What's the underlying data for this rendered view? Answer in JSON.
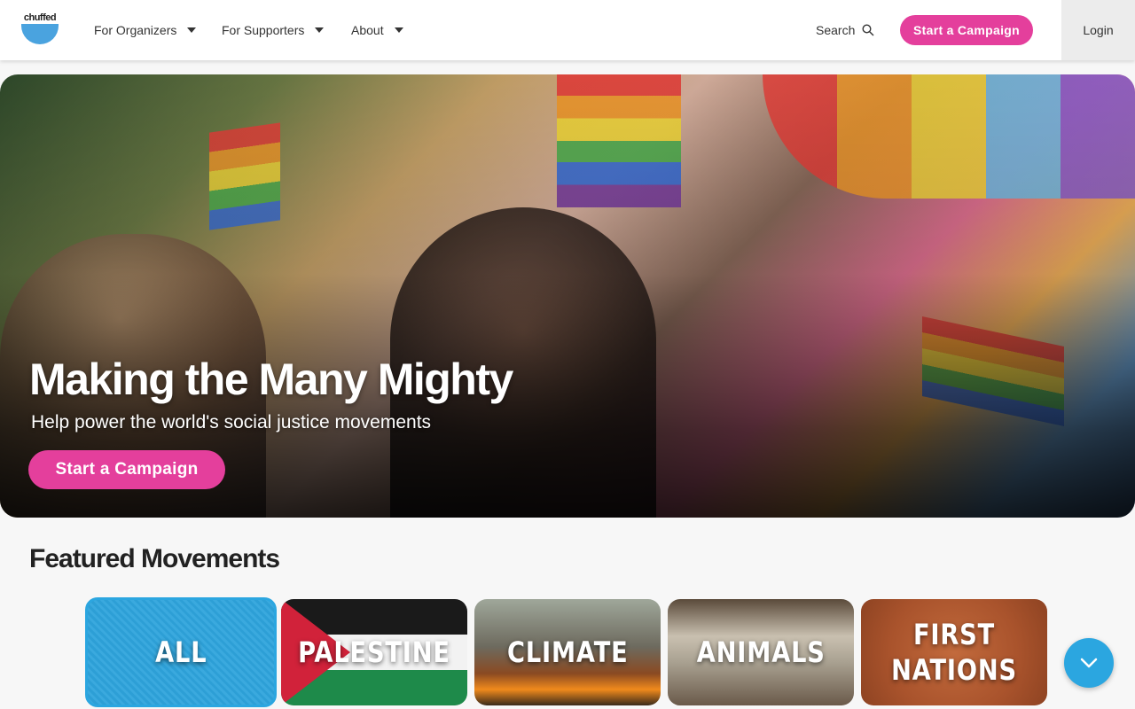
{
  "header": {
    "logo_text": "chuffed",
    "nav": [
      {
        "label": "For Organizers"
      },
      {
        "label": "For Supporters"
      },
      {
        "label": "About"
      }
    ],
    "search_label": "Search",
    "cta_label": "Start a Campaign",
    "login_label": "Login"
  },
  "hero": {
    "title": "Making the Many Mighty",
    "subtitle": "Help power the world's social justice movements",
    "cta_label": "Start a Campaign"
  },
  "featured": {
    "title": "Featured Movements",
    "tiles": [
      {
        "label": "ALL"
      },
      {
        "label": "PALESTINE"
      },
      {
        "label": "CLIMATE"
      },
      {
        "label": "ANIMALS"
      },
      {
        "label": "FIRST NATIONS"
      }
    ]
  },
  "colors": {
    "brand_pink": "#e43f9c",
    "brand_blue": "#2ba6e0"
  }
}
